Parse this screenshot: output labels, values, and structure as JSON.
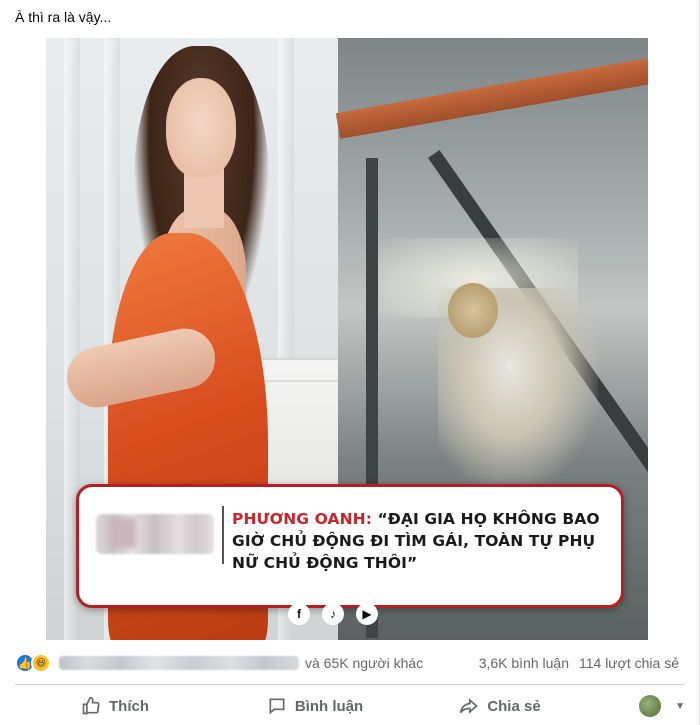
{
  "post": {
    "caption": "À thì ra là vậy...",
    "quote": {
      "speaker": "PHƯƠNG OANH:",
      "text": "“ĐẠI GIA HỌ KHÔNG BAO GIỜ CHỦ ĐỘNG ĐI TÌM GÁI, TOÀN TỰ PHỤ NỮ CHỦ ĐỘNG THÔI”"
    },
    "social_icons": [
      "facebook-icon",
      "tiktok-icon",
      "youtube-icon"
    ]
  },
  "reactions": {
    "types": [
      "like",
      "haha"
    ],
    "others_text": "và 65K người khác"
  },
  "counts": {
    "comments": "3,6K bình luận",
    "shares": "114 lượt chia sẻ"
  },
  "actions": {
    "like": "Thích",
    "comment": "Bình luận",
    "share": "Chia sẻ"
  },
  "colors": {
    "like_blue": "#1b74e4",
    "banner_red": "#b81f24",
    "speaker_red": "#c8262b",
    "secondary_text": "#65676b"
  }
}
